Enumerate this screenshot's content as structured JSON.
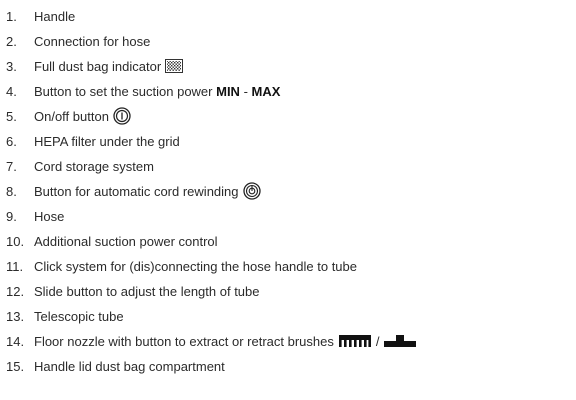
{
  "items": [
    {
      "num": "1.",
      "text": "Handle"
    },
    {
      "num": "2.",
      "text": "Connection for hose"
    },
    {
      "num": "3.",
      "text": "Full dust bag indicator",
      "icon": "dust-bag-indicator-icon"
    },
    {
      "num": "4.",
      "text": "Button to set the suction power ",
      "bold1": "MIN",
      "sep": " - ",
      "bold2": "MAX"
    },
    {
      "num": "5.",
      "text": "On/off button",
      "icon": "power-button-icon"
    },
    {
      "num": "6.",
      "text": "HEPA filter under the grid"
    },
    {
      "num": "7.",
      "text": "Cord storage system"
    },
    {
      "num": "8.",
      "text": "Button for automatic cord rewinding",
      "icon": "cord-rewind-icon"
    },
    {
      "num": "9.",
      "text": "Hose"
    },
    {
      "num": "10.",
      "text": "Additional suction power control"
    },
    {
      "num": "11.",
      "text": "Click system for (dis)connecting the hose handle to tube"
    },
    {
      "num": "12.",
      "text": "Slide button to adjust the length of tube"
    },
    {
      "num": "13.",
      "text": "Telescopic tube"
    },
    {
      "num": "14.",
      "text": "Floor nozzle with button to extract or retract brushes",
      "icon": "brush-extended-icon",
      "separator": "/",
      "icon2": "brush-retracted-icon"
    },
    {
      "num": "15.",
      "text": "Handle lid dust bag compartment"
    }
  ]
}
